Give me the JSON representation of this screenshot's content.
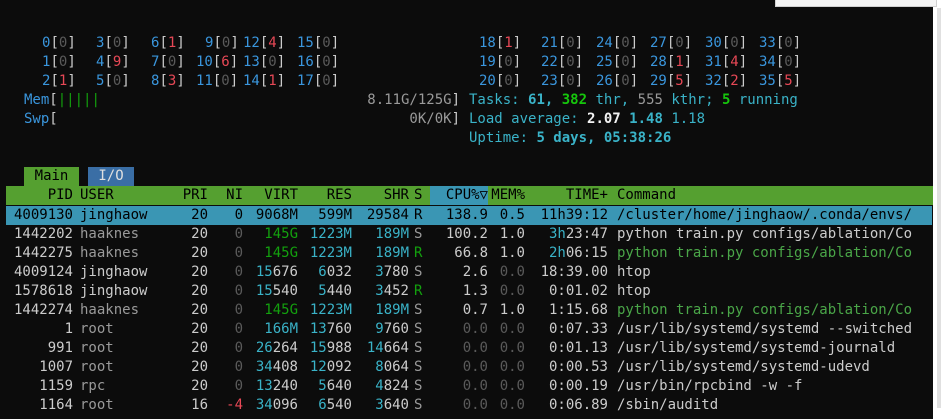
{
  "cpus": {
    "left": [
      {
        "id": "0",
        "v": "0"
      },
      {
        "id": "1",
        "v": "0"
      },
      {
        "id": "2",
        "v": "1"
      },
      {
        "id": "3",
        "v": "0"
      },
      {
        "id": "4",
        "v": "9"
      },
      {
        "id": "5",
        "v": "0"
      },
      {
        "id": "6",
        "v": "1"
      },
      {
        "id": "7",
        "v": "0"
      },
      {
        "id": "8",
        "v": "3"
      },
      {
        "id": "9",
        "v": "0"
      },
      {
        "id": "10",
        "v": "6"
      },
      {
        "id": "11",
        "v": "0"
      },
      {
        "id": "12",
        "v": "4"
      },
      {
        "id": "13",
        "v": "0"
      },
      {
        "id": "14",
        "v": "1"
      },
      {
        "id": "15",
        "v": "0"
      },
      {
        "id": "16",
        "v": "0"
      },
      {
        "id": "17",
        "v": "0"
      }
    ],
    "right": [
      {
        "id": "18",
        "v": "1"
      },
      {
        "id": "19",
        "v": "0"
      },
      {
        "id": "20",
        "v": "0"
      },
      {
        "id": "21",
        "v": "0"
      },
      {
        "id": "22",
        "v": "0"
      },
      {
        "id": "23",
        "v": "0"
      },
      {
        "id": "24",
        "v": "0"
      },
      {
        "id": "25",
        "v": "0"
      },
      {
        "id": "26",
        "v": "0"
      },
      {
        "id": "27",
        "v": "0"
      },
      {
        "id": "28",
        "v": "1"
      },
      {
        "id": "29",
        "v": "5"
      },
      {
        "id": "30",
        "v": "0"
      },
      {
        "id": "31",
        "v": "4"
      },
      {
        "id": "32",
        "v": "2"
      },
      {
        "id": "33",
        "v": "0"
      },
      {
        "id": "34",
        "v": "0"
      },
      {
        "id": "35",
        "v": "5"
      }
    ]
  },
  "mem": {
    "label": "Mem",
    "bar": "|||||",
    "value": "8.11G/125G"
  },
  "swp": {
    "label": "Swp",
    "value": "0K/0K"
  },
  "tasks": {
    "label": "Tasks:",
    "count": "61",
    "sep": ",",
    "threads": "382",
    "thr": "thr,",
    "kthreads": "555",
    "kthr": "kthr;",
    "running": "5",
    "running_label": "running"
  },
  "load": {
    "label": "Load average:",
    "l1": "2.07",
    "l5": "1.48",
    "l15": "1.18"
  },
  "uptime": {
    "label": "Uptime:",
    "value": "5 days, 05:38:26"
  },
  "tabs": {
    "main": "Main",
    "io": "I/O"
  },
  "columns": {
    "pid": "PID",
    "user": "USER",
    "pri": "PRI",
    "ni": "NI",
    "virt": "VIRT",
    "res": "RES",
    "shr": "SHR",
    "s": "S",
    "cpu": "CPU%▽",
    "mem": "MEM%",
    "time": "TIME+",
    "command": "Command"
  },
  "processes": [
    {
      "pid": "4009130",
      "user": "jinghaow",
      "pri": "20",
      "ni": "0",
      "virt": "9068M",
      "res": "599M",
      "shr": "29584",
      "s": "R",
      "cpu": "138.9",
      "mem": "0.5",
      "time": "11h39:12",
      "command": "/cluster/home/jinghaow/.conda/envs/"
    },
    {
      "pid": "1442202",
      "user": "haaknes",
      "pri": "20",
      "ni": "0",
      "virt": "145G",
      "res": "1223M",
      "shr": "189M",
      "s": "S",
      "cpu": "100.2",
      "mem": "1.0",
      "time_h": "3h",
      "time_r": "23:47",
      "command": "python train.py configs/ablation/Co"
    },
    {
      "pid": "1442275",
      "user": "haaknes",
      "pri": "20",
      "ni": "0",
      "virt": "145G",
      "res": "1223M",
      "shr": "189M",
      "s": "R",
      "cpu": "66.8",
      "mem": "1.0",
      "time_h": "2h",
      "time_r": "06:15",
      "command": "python train.py configs/ablation/Co"
    },
    {
      "pid": "4009124",
      "user": "jinghaow",
      "pri": "20",
      "ni": "0",
      "virt_a": "15",
      "virt_b": "676",
      "res_a": "6",
      "res_b": "032",
      "shr_a": "3",
      "shr_b": "780",
      "s": "S",
      "cpu": "2.6",
      "mem": "0.0",
      "time": "18:39.00",
      "command": "htop"
    },
    {
      "pid": "1578618",
      "user": "jinghaow",
      "pri": "20",
      "ni": "0",
      "virt_a": "15",
      "virt_b": "540",
      "res_a": "5",
      "res_b": "440",
      "shr_a": "3",
      "shr_b": "452",
      "s": "R",
      "cpu": "1.3",
      "mem": "0.0",
      "time": "0:01.02",
      "command": "htop"
    },
    {
      "pid": "1442274",
      "user": "haaknes",
      "pri": "20",
      "ni": "0",
      "virt": "145G",
      "res": "1223M",
      "shr": "189M",
      "s": "S",
      "cpu": "0.7",
      "mem": "1.0",
      "time": "1:15.68",
      "command": "python train.py configs/ablation/Co"
    },
    {
      "pid": "1",
      "user": "root",
      "pri": "20",
      "ni": "0",
      "virt": "166M",
      "res_a": "13",
      "res_b": "760",
      "shr_a": "9",
      "shr_b": "760",
      "s": "S",
      "cpu": "0.0",
      "mem": "0.0",
      "time": "0:07.33",
      "command": "/usr/lib/systemd/systemd --switched"
    },
    {
      "pid": "991",
      "user": "root",
      "pri": "20",
      "ni": "0",
      "virt_a": "26",
      "virt_b": "264",
      "res_a": "15",
      "res_b": "988",
      "shr_a": "14",
      "shr_b": "664",
      "s": "S",
      "cpu": "0.0",
      "mem": "0.0",
      "time": "0:01.13",
      "command": "/usr/lib/systemd/systemd-journald"
    },
    {
      "pid": "1007",
      "user": "root",
      "pri": "20",
      "ni": "0",
      "virt_a": "34",
      "virt_b": "408",
      "res_a": "12",
      "res_b": "092",
      "shr_a": "8",
      "shr_b": "064",
      "s": "S",
      "cpu": "0.0",
      "mem": "0.0",
      "time": "0:00.53",
      "command": "/usr/lib/systemd/systemd-udevd"
    },
    {
      "pid": "1159",
      "user": "rpc",
      "pri": "20",
      "ni": "0",
      "virt_a": "13",
      "virt_b": "240",
      "res_a": "5",
      "res_b": "640",
      "shr_a": "4",
      "shr_b": "824",
      "s": "S",
      "cpu": "0.0",
      "mem": "0.0",
      "time": "0:00.19",
      "command": "/usr/bin/rpcbind -w -f"
    },
    {
      "pid": "1164",
      "user": "root",
      "pri": "16",
      "ni": "-4",
      "virt_a": "34",
      "virt_b": "096",
      "res_a": "6",
      "res_b": "540",
      "shr_a": "3",
      "shr_b": "640",
      "s": "S",
      "cpu": "0.0",
      "mem": "0.0",
      "time": "0:06.89",
      "command": "/sbin/auditd"
    }
  ],
  "colors": {
    "background": "#0c0c0c",
    "header_bar": "#55a030",
    "selected_row": "#3a96b4",
    "tab_active": "#55a030",
    "tab_inactive": "#3a6ea5",
    "accent_cyan": "#3a96dd",
    "red": "#e74856",
    "green": "#13a10e"
  }
}
